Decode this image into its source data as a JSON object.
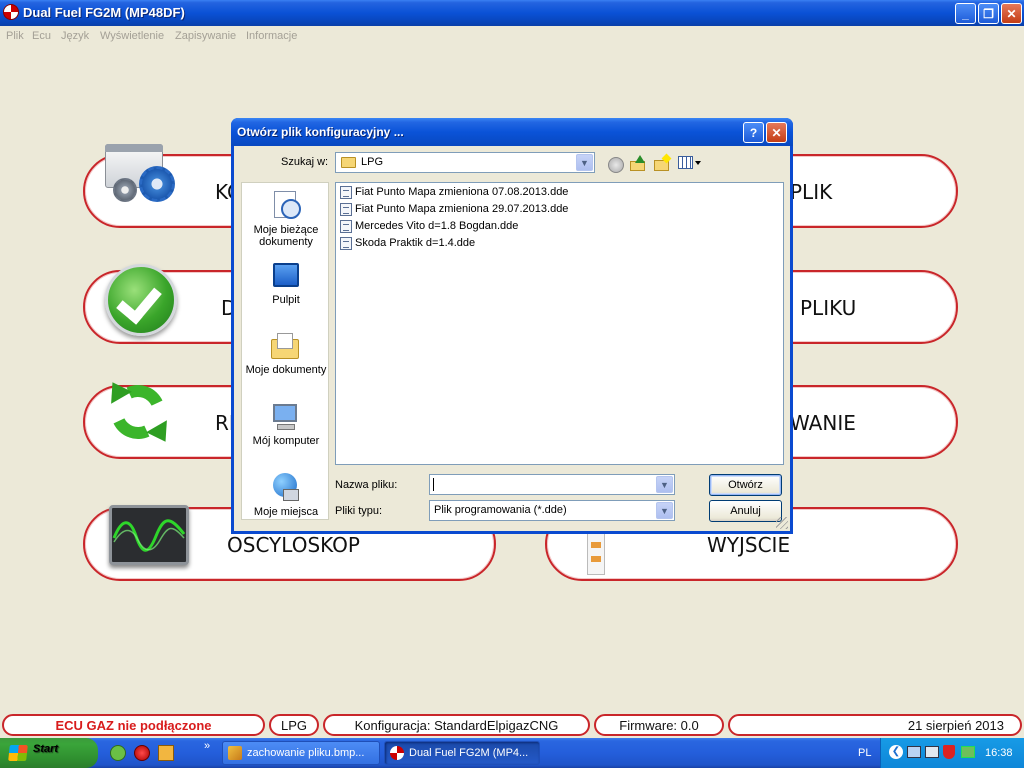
{
  "window": {
    "title": "Dual Fuel FG2M (MP48DF)",
    "controls": {
      "minimize": "_",
      "maximize": "❐",
      "close": "✕"
    }
  },
  "menu": [
    "Plik",
    "Ecu",
    "Język",
    "Wyświetlenie",
    "Zapisywanie",
    "Informacje"
  ],
  "tiles": {
    "left": [
      "KO",
      "D",
      "RI",
      "OSCYLOSKOP"
    ],
    "right": [
      "PLIK",
      "PLIKU",
      "WANIE",
      "WYJSCIE"
    ]
  },
  "dialog": {
    "title": "Otwórz plik konfiguracyjny ...",
    "help": "?",
    "close": "✕",
    "look_in_label": "Szukaj w:",
    "look_in_value": "LPG",
    "places": [
      "Moje bieżące dokumenty",
      "Pulpit",
      "Moje dokumenty",
      "Mój komputer",
      "Moje miejsca"
    ],
    "files": [
      "Fiat Punto Mapa zmieniona 07.08.2013.dde",
      "Fiat Punto Mapa zmieniona 29.07.2013.dde",
      "Mercedes Vito d=1.8 Bogdan.dde",
      "Skoda Praktik d=1.4.dde"
    ],
    "filename_label": "Nazwa pliku:",
    "filename_value": "",
    "filetype_label": "Pliki typu:",
    "filetype_value": "Plik programowania (*.dde)",
    "open_button": "Otwórz",
    "cancel_button": "Anuluj"
  },
  "statusbar": {
    "ecu": "ECU GAZ nie podłączone",
    "fuel": "LPG",
    "config": "Konfiguracja: StandardElpigazCNG",
    "firmware": "Firmware: 0.0",
    "date": "21 sierpień 2013"
  },
  "taskbar": {
    "start": "Start",
    "quick_launch_more": "»",
    "tasks": [
      "zachowanie pliku.bmp...",
      "Dual Fuel FG2M (MP4..."
    ],
    "lang": "PL",
    "clock": "16:38"
  },
  "colors": {
    "accent_red": "#c9262a",
    "status_red": "#d81c1c",
    "xp_blue": "#0a4ad0"
  }
}
